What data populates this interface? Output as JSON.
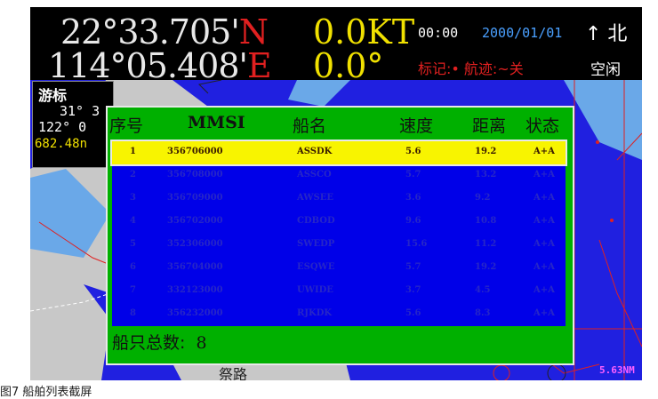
{
  "header": {
    "lat_deg": "22°",
    "lat_min": "33.705'",
    "lat_hemi": "N",
    "lon_deg": "114°",
    "lon_min": "05.408'",
    "lon_hemi": "E",
    "speed": "0.0KT",
    "course": "0.0°",
    "time": "00:00",
    "date": "2000/01/01",
    "heading": "↑ 北",
    "marks": "标记:• 航迹:~关",
    "status": "空闲"
  },
  "cursor_panel": {
    "title": "游标",
    "lat": "31° 3",
    "lon": "122° 0",
    "distance": "682.48n"
  },
  "map": {
    "place_name": "祭路",
    "distance_readout": "5.63NM"
  },
  "dialog": {
    "columns": [
      "序号",
      "MMSI",
      "船名",
      "速度",
      "距离",
      "状态"
    ],
    "rows": [
      {
        "no": "1",
        "mmsi": "356706000",
        "name": "ASSDK",
        "speed": "5.6",
        "dist": "19.2",
        "state": "A+A"
      },
      {
        "no": "2",
        "mmsi": "356708000",
        "name": "ASSCO",
        "speed": "5.7",
        "dist": "13.2",
        "state": "A+A"
      },
      {
        "no": "3",
        "mmsi": "356709000",
        "name": "AWSEE",
        "speed": "3.6",
        "dist": "9.2",
        "state": "A+A"
      },
      {
        "no": "4",
        "mmsi": "356702000",
        "name": "CDBOD",
        "speed": "9.6",
        "dist": "10.8",
        "state": "A+A"
      },
      {
        "no": "5",
        "mmsi": "352306000",
        "name": "SWEDP",
        "speed": "15.6",
        "dist": "11.2",
        "state": "A+A"
      },
      {
        "no": "6",
        "mmsi": "356704000",
        "name": "ESQWE",
        "speed": "5.7",
        "dist": "19.2",
        "state": "A+A"
      },
      {
        "no": "7",
        "mmsi": "332123000",
        "name": "UWIDE",
        "speed": "3.7",
        "dist": "4.5",
        "state": "A+A"
      },
      {
        "no": "8",
        "mmsi": "356232000",
        "name": "RJKDK",
        "speed": "5.6",
        "dist": "8.3",
        "state": "A+A"
      }
    ],
    "selected_index": 0,
    "footer_label": "船只总数:",
    "footer_count": "8"
  },
  "caption": "图7 船舶列表截屏",
  "colors": {
    "background": "#000000",
    "dialog": "#00b000",
    "list": "#0000e8",
    "selected": "#f8f400",
    "sea": "#2020e0",
    "land": "#c8c8c8",
    "shallow": "#6aa8e8"
  }
}
